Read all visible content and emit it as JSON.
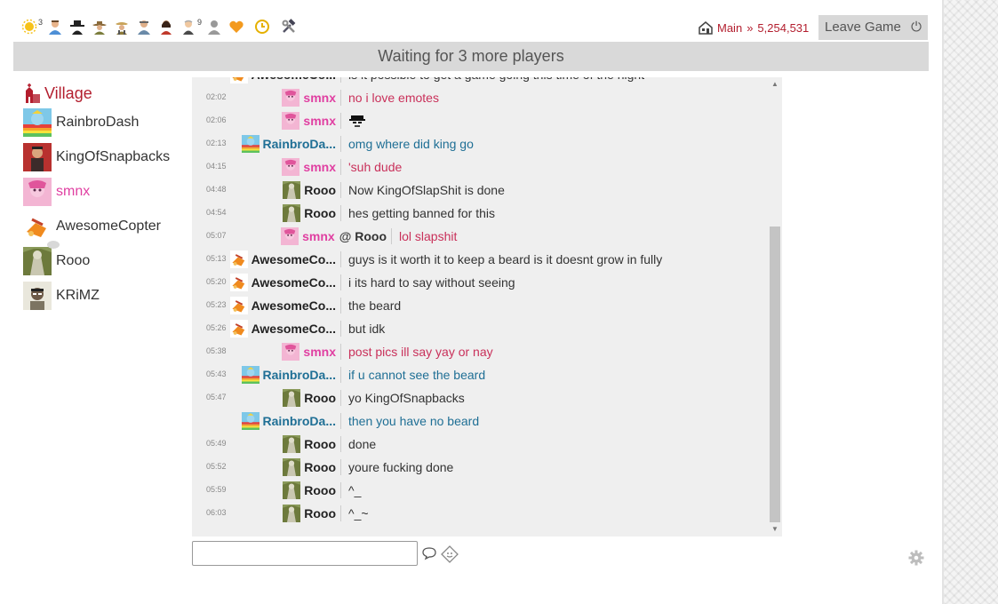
{
  "top_bar": {
    "role_icons": [
      {
        "icon": "sun-icon",
        "count": "3"
      },
      {
        "icon": "villager-blue-icon",
        "count": ""
      },
      {
        "icon": "mafia-hat-icon",
        "count": ""
      },
      {
        "icon": "cowboy-icon",
        "count": ""
      },
      {
        "icon": "farmer-icon",
        "count": ""
      },
      {
        "icon": "doctor-icon",
        "count": ""
      },
      {
        "icon": "woman-icon",
        "count": ""
      },
      {
        "icon": "grandpa-icon",
        "count": "9"
      },
      {
        "icon": "gray-person-icon",
        "count": ""
      },
      {
        "icon": "orange-heart-icon",
        "count": ""
      }
    ],
    "tools": [
      {
        "icon": "clock-icon"
      },
      {
        "icon": "hammer-wrench-icon"
      }
    ],
    "setup": {
      "name": "Main",
      "separator": "»",
      "id": "5,254,531"
    },
    "leave_label": "Leave Game"
  },
  "status": {
    "text": "Waiting for 3 more players"
  },
  "village": {
    "label": "Village"
  },
  "players": [
    {
      "name": "RainbroDash",
      "avatar": "rainbow"
    },
    {
      "name": "KingOfSnapbacks",
      "avatar": "king"
    },
    {
      "name": "smnx",
      "avatar": "pink"
    },
    {
      "name": "AwesomeCopter",
      "avatar": "copter"
    },
    {
      "name": "Rooo",
      "avatar": "rooo"
    },
    {
      "name": "KRiMZ",
      "avatar": "krimz"
    }
  ],
  "chat": {
    "messages": [
      {
        "time": "",
        "user": "AwesomeCo...",
        "avatar": "copter",
        "color": "dark",
        "text": "is it possible to get a game going this time of the night"
      },
      {
        "time": "02:02",
        "user": "smnx",
        "avatar": "pink",
        "color": "pink",
        "text": "no i love emotes"
      },
      {
        "time": "02:06",
        "user": "smnx",
        "avatar": "pink",
        "color": "pink",
        "text": "",
        "emote": "heisenberg"
      },
      {
        "time": "02:13",
        "user": "RainbroDa...",
        "avatar": "rainbow",
        "color": "blue",
        "text": "omg where did king go"
      },
      {
        "time": "04:15",
        "user": "smnx",
        "avatar": "pink",
        "color": "pink",
        "text": "'suh dude"
      },
      {
        "time": "04:48",
        "user": "Rooo",
        "avatar": "rooo",
        "color": "dark",
        "text": "Now KingOfSlapShit is done"
      },
      {
        "time": "04:54",
        "user": "Rooo",
        "avatar": "rooo",
        "color": "dark",
        "text": "hes getting banned for this"
      },
      {
        "time": "05:07",
        "user": "smnx",
        "avatar": "pink",
        "color": "pink",
        "text": "lol slapshit",
        "to": "Rooo"
      },
      {
        "time": "05:13",
        "user": "AwesomeCo...",
        "avatar": "copter",
        "color": "dark",
        "text": "guys is it worth it to keep a beard is it doesnt grow in fully"
      },
      {
        "time": "05:20",
        "user": "AwesomeCo...",
        "avatar": "copter",
        "color": "dark",
        "text": "i its hard to say without seeing"
      },
      {
        "time": "05:23",
        "user": "AwesomeCo...",
        "avatar": "copter",
        "color": "dark",
        "text": "the beard"
      },
      {
        "time": "05:26",
        "user": "AwesomeCo...",
        "avatar": "copter",
        "color": "dark",
        "text": "but idk"
      },
      {
        "time": "05:38",
        "user": "smnx",
        "avatar": "pink",
        "color": "pink",
        "text": "post pics ill say yay or nay"
      },
      {
        "time": "05:43",
        "user": "RainbroDa...",
        "avatar": "rainbow",
        "color": "blue",
        "text": "if u cannot see the beard"
      },
      {
        "time": "05:47",
        "user": "Rooo",
        "avatar": "rooo",
        "color": "dark",
        "text": "yo KingOfSnapbacks"
      },
      {
        "time": "",
        "user": "RainbroDa...",
        "avatar": "rainbow",
        "color": "blue",
        "text": "then you have no beard"
      },
      {
        "time": "05:49",
        "user": "Rooo",
        "avatar": "rooo",
        "color": "dark",
        "text": "done"
      },
      {
        "time": "05:52",
        "user": "Rooo",
        "avatar": "rooo",
        "color": "dark",
        "text": "youre fucking done"
      },
      {
        "time": "05:59",
        "user": "Rooo",
        "avatar": "rooo",
        "color": "dark",
        "text": "^_"
      },
      {
        "time": "06:03",
        "user": "Rooo",
        "avatar": "rooo",
        "color": "dark",
        "text": "^_~"
      }
    ]
  },
  "input": {
    "placeholder": ""
  },
  "icons": {
    "speech": "speech-bubble-icon",
    "emote": "emote-picker-icon",
    "settings": "gear-icon"
  }
}
